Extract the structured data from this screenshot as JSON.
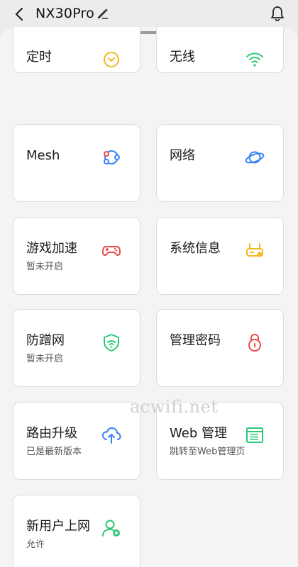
{
  "header": {
    "title": "NX30Pro",
    "back_icon": "chevron-left-icon",
    "edit_icon": "edit-pencil-icon",
    "bell_icon": "bell-icon"
  },
  "cards": [
    {
      "label": "定时",
      "sub": "",
      "icon": "clock-icon",
      "color": "#f5b81c"
    },
    {
      "label": "无线",
      "sub": "",
      "icon": "wifi-icon",
      "color": "#2ec97a"
    },
    {
      "label": "Mesh",
      "sub": "",
      "icon": "mesh-icon",
      "color": "#3b82f6"
    },
    {
      "label": "网络",
      "sub": "",
      "icon": "planet-icon",
      "color": "#3b82f6"
    },
    {
      "label": "游戏加速",
      "sub": "暂未开启",
      "icon": "gamepad-icon",
      "color": "#ef4b4b"
    },
    {
      "label": "系统信息",
      "sub": "",
      "icon": "router-icon",
      "color": "#f5b81c"
    },
    {
      "label": "防蹭网",
      "sub": "暂未开启",
      "icon": "shield-icon",
      "color": "#2ec97a"
    },
    {
      "label": "管理密码",
      "sub": "",
      "icon": "lock-icon",
      "color": "#ef4b4b"
    },
    {
      "label": "路由升级",
      "sub": "已是最新版本",
      "icon": "cloud-upload-icon",
      "color": "#3b82f6"
    },
    {
      "label": "Web 管理",
      "sub": "跳转至Web管理页",
      "icon": "browser-window-icon",
      "color": "#2ec97a"
    },
    {
      "label": "新用户上网",
      "sub": "允许",
      "icon": "user-add-icon",
      "color": "#2ec97a"
    }
  ],
  "watermark": "acwifi.net"
}
